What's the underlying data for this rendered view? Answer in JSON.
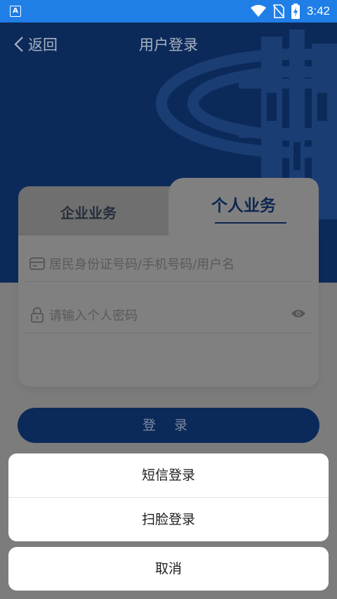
{
  "status_bar": {
    "time": "3:42",
    "app_icon_letter": "A",
    "icons": [
      "app-notification-icon",
      "wifi-icon",
      "no-sim-icon",
      "battery-charging-icon"
    ]
  },
  "nav": {
    "back_label": "返回",
    "title": "用户登录"
  },
  "tabs": [
    {
      "label": "企业业务",
      "active": false
    },
    {
      "label": "个人业务",
      "active": true
    }
  ],
  "form": {
    "username_placeholder": "居民身份证号码/手机号码/用户名",
    "password_placeholder": "请输入个人密码",
    "login_label": "登 录"
  },
  "action_sheet": {
    "items": [
      "短信登录",
      "扫脸登录"
    ],
    "cancel_label": "取消"
  },
  "colors": {
    "status_bar": "#1f7fe6",
    "hero": "#0c2a59",
    "overlay_content": "#7c7c7c",
    "accent": "#0d2651",
    "sheet": "#ffffff"
  }
}
